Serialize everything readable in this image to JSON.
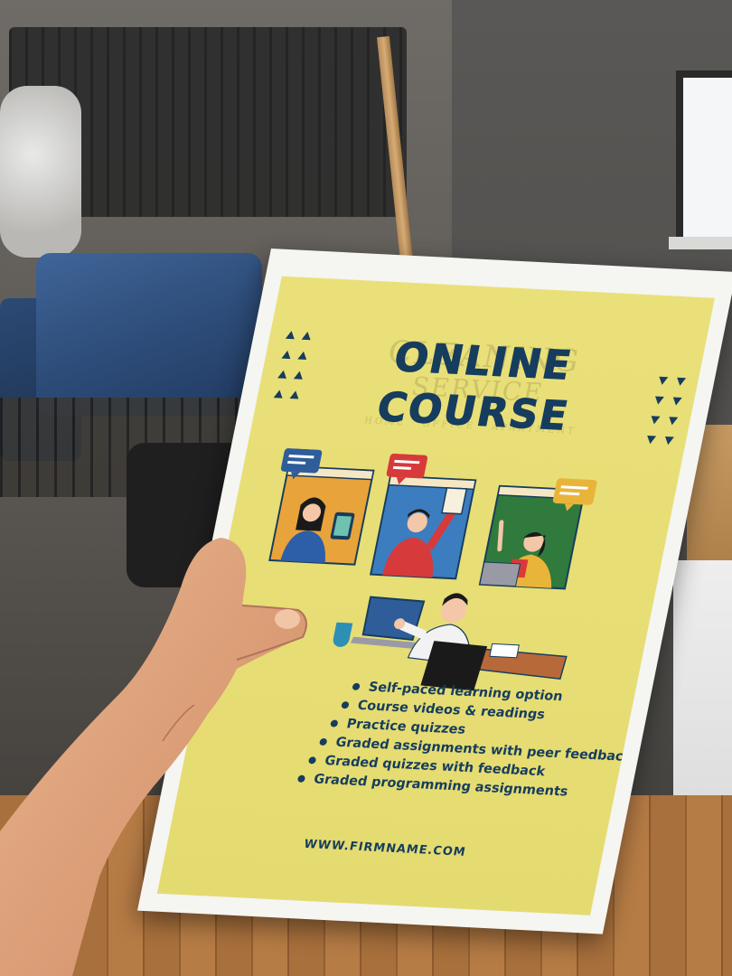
{
  "flyer": {
    "title_line1": "ONLINE",
    "title_line2": "COURSE",
    "ghost_line1": "CLEANING",
    "ghost_line2": "SERVICE",
    "ghost_line3": "HOME · OFFICE · APARTMENT",
    "features": [
      "Self-paced learning option",
      "Course videos & readings",
      "Practice quizzes",
      "Graded assignments with peer feedback",
      "Graded quizzes with feedback",
      "Graded programming assignments"
    ],
    "url": "WWW.FIRMNAME.COM"
  },
  "colors": {
    "flyer_background": "#e8df76",
    "title_navy": "#163d5e",
    "panel_orange": "#e8a33a",
    "panel_blue": "#3c7dbf",
    "panel_green": "#2f7a3c",
    "bubble_red": "#d63a3a",
    "bubble_blue": "#2e5d9a",
    "bubble_yellow": "#e8b43a"
  },
  "icons": [
    "chat-bubble-icon",
    "video-call-window-icon",
    "laptop-icon",
    "coffee-mug-icon",
    "triangle-pattern-icon"
  ]
}
